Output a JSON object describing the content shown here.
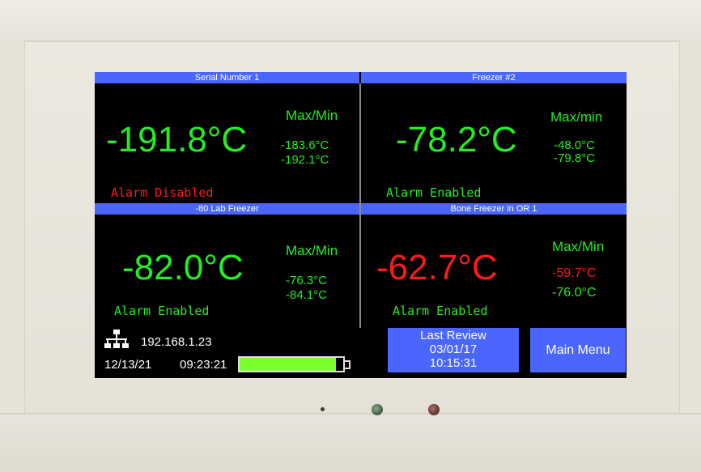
{
  "panels": [
    {
      "name": "Serial Number 1",
      "temperature": "-191.8°C",
      "maxmin_label": "Max/Min",
      "max": "-183.6°C",
      "min": "-192.1°C",
      "alarm": "Alarm Disabled"
    },
    {
      "name": "Freezer #2",
      "temperature": "-78.2°C",
      "maxmin_label": "Max/min",
      "max": "-48.0°C",
      "min": "-79.8°C",
      "alarm": "Alarm Enabled"
    },
    {
      "name": "-80 Lab Freezer",
      "temperature": "-82.0°C",
      "maxmin_label": "Max/Min",
      "max": "-76.3°C",
      "min": "-84.1°C",
      "alarm": "Alarm Enabled"
    },
    {
      "name": "Bone Freezer in OR 1",
      "temperature": "-62.7°C",
      "maxmin_label": "Max/Min",
      "max": "-59.7°C",
      "min": "-76.0°C",
      "alarm": "Alarm Enabled"
    }
  ],
  "footer": {
    "ip_address": "192.168.1.23",
    "date": "12/13/21",
    "time": "09:23:21",
    "battery_level_fraction": 0.93,
    "last_review": {
      "label": "Last Review",
      "date": "03/01/17",
      "time": "10:15:31"
    },
    "main_menu_label": "Main Menu"
  },
  "icons": {
    "network": "network-icon",
    "battery": "battery-icon"
  },
  "colors": {
    "header_bar": "#4a66ff",
    "normal_reading": "#22ee22",
    "alarm_reading": "#ff1a1a",
    "battery_fill": "#7cff2a",
    "led_green": "#4a6a48",
    "led_red": "#6a3a34"
  }
}
